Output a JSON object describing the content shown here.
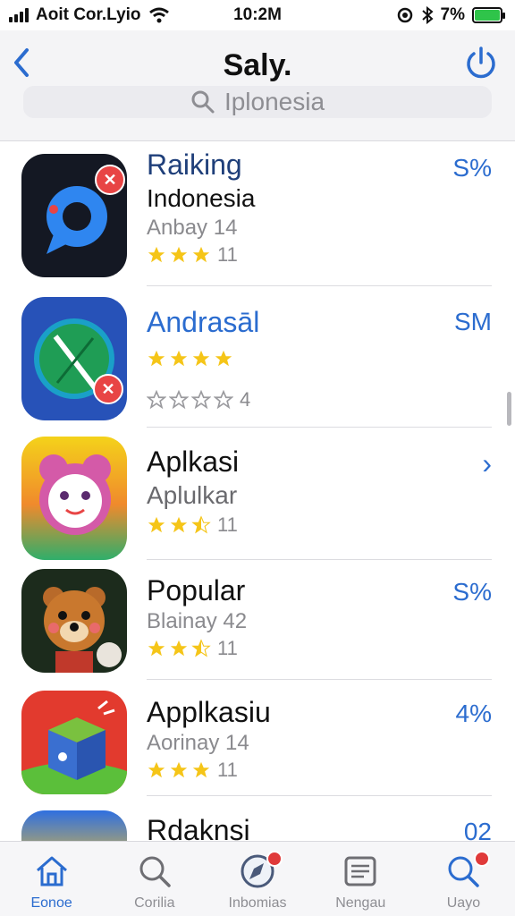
{
  "status": {
    "carrier": "Aoit Cor.Lyio",
    "time": "10:2M",
    "battery": "7%",
    "colors": {
      "battery": "#2fc44a"
    }
  },
  "header": {
    "title": "Saly.",
    "search_placeholder": "Iplonesia",
    "back_icon": "chevron-left-icon",
    "power_icon": "power-icon"
  },
  "apps": [
    {
      "name": "Raiking",
      "line2": "Indonesia",
      "sub": "Anbay 14",
      "rating": 3,
      "rating_count": "11",
      "right": "S%",
      "name_color": "#1f3f7a"
    },
    {
      "name": "Andrasāl",
      "line2": "",
      "sub": "",
      "rating": 4,
      "rating_count": "",
      "second_rating": 0,
      "second_count": "4",
      "right": "SM",
      "name_color": "#2b6ccf"
    },
    {
      "name": "Aplkasi",
      "line2": "Aplulkar",
      "sub": "",
      "rating": 2.5,
      "rating_count": "11",
      "right": "›",
      "name_color": "#111111"
    },
    {
      "name": "Popular",
      "line2": "",
      "sub": "Blainay 42",
      "rating": 2.5,
      "rating_count": "11",
      "right": "S%",
      "name_color": "#111111"
    },
    {
      "name": "Applkasiu",
      "line2": "",
      "sub": "Aorinay 14",
      "rating": 3,
      "rating_count": "11",
      "right": "4%",
      "name_color": "#111111"
    },
    {
      "name": "Rdaknsi",
      "line2": "",
      "sub": "",
      "rating": 0,
      "rating_count": "",
      "right": "02",
      "name_color": "#111111"
    }
  ],
  "tabs": [
    {
      "label": "Eonoe",
      "icon": "home-icon",
      "active": true
    },
    {
      "label": "Corilia",
      "icon": "search-icon",
      "active": false
    },
    {
      "label": "Inbomias",
      "icon": "compass-icon",
      "active": false,
      "badge": true
    },
    {
      "label": "Nengau",
      "icon": "news-icon",
      "active": false
    },
    {
      "label": "Uayo",
      "icon": "search-badge-icon",
      "active": false,
      "badge": true
    }
  ],
  "colors": {
    "accent": "#2b6ccf",
    "star": "#f5c518",
    "badge": "#e84545"
  }
}
